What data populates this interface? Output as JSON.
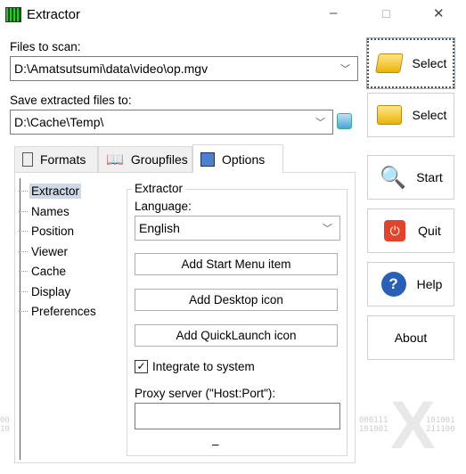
{
  "window": {
    "title": "Extractor",
    "minimize": "–",
    "maximize": "☐",
    "close": "✕"
  },
  "files_to_scan": {
    "label": "Files to scan:",
    "value": "D:\\Amatsutsumi\\data\\video\\op.mgv"
  },
  "save_to": {
    "label": "Save extracted files to:",
    "value": "D:\\Cache\\Temp\\"
  },
  "tabs": [
    {
      "label": "Formats",
      "icon": "document-icon"
    },
    {
      "label": "Groupfiles",
      "icon": "book-icon"
    },
    {
      "label": "Options",
      "icon": "options-icon",
      "active": true
    }
  ],
  "tree": [
    "Extractor",
    "Names",
    "Position",
    "Viewer",
    "Cache",
    "Display",
    "Preferences"
  ],
  "options": {
    "group_title": "Extractor",
    "language_label": "Language:",
    "language_value": "English",
    "add_start_menu": "Add Start Menu item",
    "add_desktop": "Add Desktop icon",
    "add_quicklaunch": "Add QuickLaunch icon",
    "integrate_label": "Integrate to system",
    "integrate_checked": true,
    "proxy_label": "Proxy server (\"Host:Port\"):",
    "proxy_value": "",
    "dash": "–"
  },
  "buttons": {
    "select1": "Select",
    "select2": "Select",
    "start": "Start",
    "quit": "Quit",
    "help": "Help",
    "about": "About"
  },
  "decor": {
    "bin_left": [
      "00",
      "10"
    ],
    "bin_right1": [
      "000111",
      "101001"
    ],
    "bin_right2": [
      "101001",
      "211100"
    ]
  }
}
